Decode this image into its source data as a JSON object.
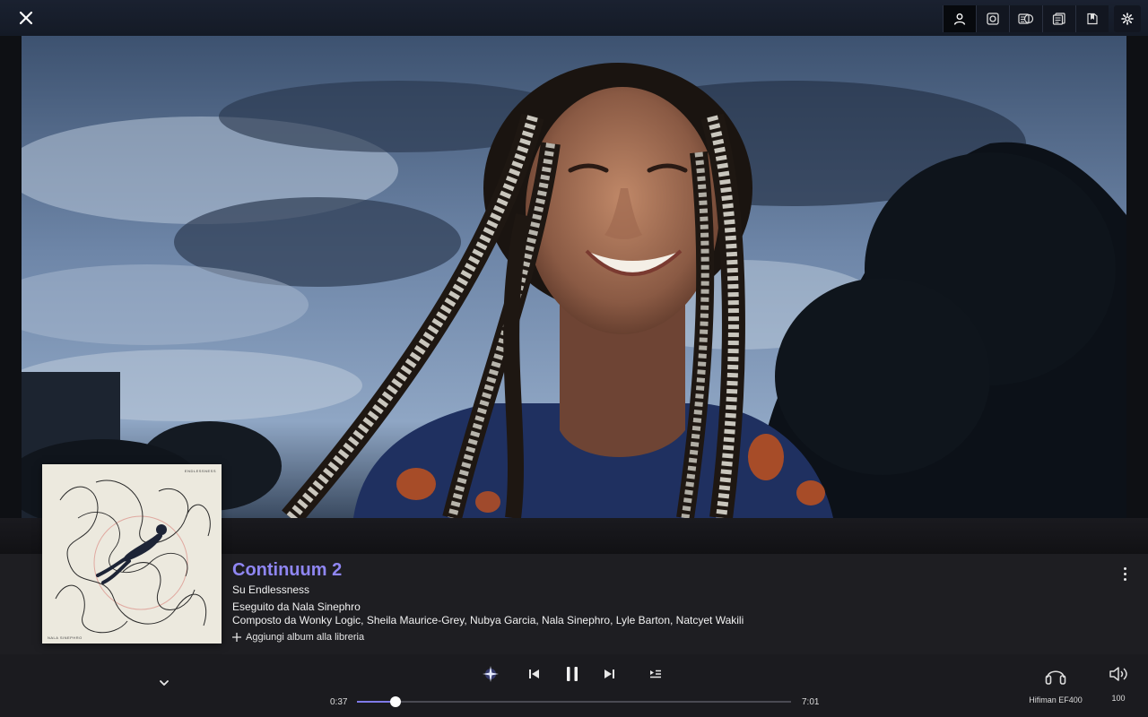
{
  "window": {
    "close_icon": "close-icon"
  },
  "toolbar": {
    "icons": [
      "person-icon",
      "disc-icon",
      "album-credits-icon",
      "booklet-icon",
      "bookmark-icon",
      "settings-icon"
    ],
    "active_index": 0
  },
  "track": {
    "title": "Continuum 2",
    "album_line": "Su Endlessness",
    "performer_line": "Eseguito da Nala Sinephro",
    "composer_line": "Composto da Wonky Logic, Sheila Maurice-Grey, Nubya Garcia, Nala Sinephro, Lyle Barton, Natcyet Wakili",
    "add_album_label": "Aggiungi album alla libreria"
  },
  "album_art": {
    "top_text": "ENDLESSNESS",
    "bottom_text": "NALA SINEPHRO"
  },
  "player": {
    "elapsed": "0:37",
    "total": "7:01",
    "progress_fraction": 0.088,
    "state": "playing"
  },
  "device": {
    "name": "Hifiman EF400",
    "icon": "headphones-icon"
  },
  "volume": {
    "level": "100",
    "icon": "speaker-icon"
  },
  "colors": {
    "accent": "#8f86f2",
    "progress": "#7f7ae8",
    "panel": "#1e1e22"
  }
}
